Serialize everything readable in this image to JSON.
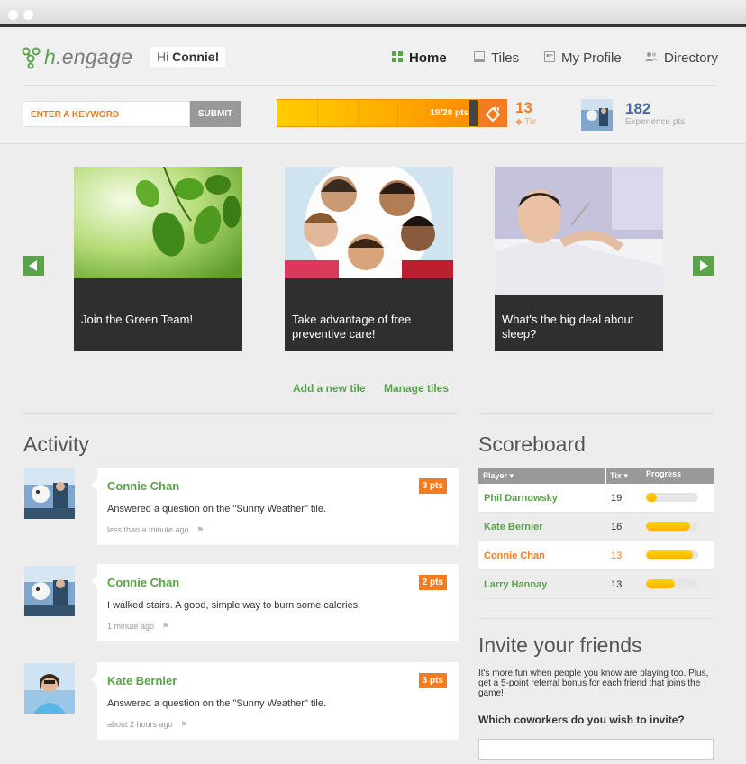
{
  "app": {
    "logo_text_h": "h",
    "logo_text": ".engage",
    "greeting_prefix": "Hi",
    "greeting_name": "Connie!"
  },
  "nav": {
    "items": [
      {
        "label": "Home",
        "icon": "grid-icon",
        "active": true
      },
      {
        "label": "Tiles",
        "icon": "tile-icon",
        "active": false
      },
      {
        "label": "My Profile",
        "icon": "profile-icon",
        "active": false
      },
      {
        "label": "Directory",
        "icon": "people-icon",
        "active": false
      }
    ]
  },
  "search": {
    "placeholder": "ENTER A KEYWORD",
    "submit_label": "SUBMIT"
  },
  "progress": {
    "label": "19/20 pts",
    "value": 19,
    "max": 20
  },
  "tix": {
    "count": "13",
    "label": "Tix"
  },
  "experience": {
    "count": "182",
    "label": "Experience pts"
  },
  "tiles": [
    {
      "caption": "Join the Green Team!"
    },
    {
      "caption": "Take advantage of free preventive care!"
    },
    {
      "caption": "What's the big deal about sleep?"
    }
  ],
  "tile_links": {
    "add": "Add a new tile",
    "manage": "Manage tiles"
  },
  "activity": {
    "title": "Activity",
    "items": [
      {
        "name": "Connie Chan",
        "text": "Answered a question on the \"Sunny Weather\" tile.",
        "time": "less than a minute ago",
        "pts": "3 pts"
      },
      {
        "name": "Connie Chan",
        "text": "I walked stairs. A good, simple way to burn some calories.",
        "time": "1 minute ago",
        "pts": "2 pts"
      },
      {
        "name": "Kate Bernier",
        "text": "Answered a question on the \"Sunny Weather\" tile.",
        "time": "about 2 hours ago",
        "pts": "3 pts"
      }
    ]
  },
  "scoreboard": {
    "title": "Scoreboard",
    "headers": {
      "player": "Player",
      "tix": "Tix",
      "progress": "Progress"
    },
    "rows": [
      {
        "player": "Phil Darnowsky",
        "tix": "19",
        "progress": 0.2,
        "highlight": false
      },
      {
        "player": "Kate Bernier",
        "tix": "16",
        "progress": 0.85,
        "highlight": false
      },
      {
        "player": "Connie Chan",
        "tix": "13",
        "progress": 0.9,
        "highlight": true
      },
      {
        "player": "Larry Hannay",
        "tix": "13",
        "progress": 0.55,
        "highlight": false
      }
    ]
  },
  "invite": {
    "title": "Invite your friends",
    "text": "It's more fun when people you know are playing too. Plus, get a 5-point referral bonus for each friend that joins the game!",
    "question": "Which coworkers do you wish to invite?"
  },
  "colors": {
    "green": "#5aa34a",
    "orange": "#f47c20",
    "blue": "#4a6ba1"
  }
}
